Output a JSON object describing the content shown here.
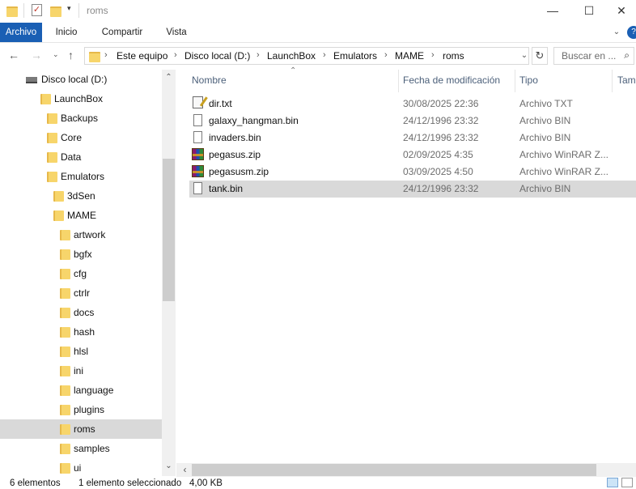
{
  "window": {
    "title": "roms",
    "minimize": "—",
    "maximize": "☐",
    "close": "✕"
  },
  "ribbon": {
    "tabs": [
      "Archivo",
      "Inicio",
      "Compartir",
      "Vista"
    ]
  },
  "address": {
    "crumbs": [
      "Este equipo",
      "Disco local (D:)",
      "LaunchBox",
      "Emulators",
      "MAME",
      "roms"
    ],
    "search_placeholder": "Buscar en ..."
  },
  "nav_tree": [
    {
      "label": "Disco local (D:)",
      "type": "drive",
      "indent": 0,
      "selected": false
    },
    {
      "label": "LaunchBox",
      "type": "folder",
      "indent": 1,
      "selected": false
    },
    {
      "label": "Backups",
      "type": "folder",
      "indent": 2,
      "selected": false
    },
    {
      "label": "Core",
      "type": "folder",
      "indent": 2,
      "selected": false
    },
    {
      "label": "Data",
      "type": "folder",
      "indent": 2,
      "selected": false
    },
    {
      "label": "Emulators",
      "type": "folder",
      "indent": 2,
      "selected": false
    },
    {
      "label": "3dSen",
      "type": "folder",
      "indent": 3,
      "selected": false
    },
    {
      "label": "MAME",
      "type": "folder",
      "indent": 3,
      "selected": false
    },
    {
      "label": "artwork",
      "type": "folder",
      "indent": 4,
      "selected": false
    },
    {
      "label": "bgfx",
      "type": "folder",
      "indent": 4,
      "selected": false
    },
    {
      "label": "cfg",
      "type": "folder",
      "indent": 4,
      "selected": false
    },
    {
      "label": "ctrlr",
      "type": "folder",
      "indent": 4,
      "selected": false
    },
    {
      "label": "docs",
      "type": "folder",
      "indent": 4,
      "selected": false
    },
    {
      "label": "hash",
      "type": "folder",
      "indent": 4,
      "selected": false
    },
    {
      "label": "hlsl",
      "type": "folder",
      "indent": 4,
      "selected": false
    },
    {
      "label": "ini",
      "type": "folder",
      "indent": 4,
      "selected": false
    },
    {
      "label": "language",
      "type": "folder",
      "indent": 4,
      "selected": false
    },
    {
      "label": "plugins",
      "type": "folder",
      "indent": 4,
      "selected": false
    },
    {
      "label": "roms",
      "type": "folder",
      "indent": 4,
      "selected": true
    },
    {
      "label": "samples",
      "type": "folder",
      "indent": 4,
      "selected": false
    },
    {
      "label": "ui",
      "type": "folder",
      "indent": 4,
      "selected": false
    }
  ],
  "columns": {
    "name": "Nombre",
    "date": "Fecha de modificación",
    "type": "Tipo",
    "size": "Tama"
  },
  "files": [
    {
      "name": "dir.txt",
      "date": "30/08/2025 22:36",
      "type": "Archivo TXT",
      "icon": "text-file-icon",
      "selected": false
    },
    {
      "name": "galaxy_hangman.bin",
      "date": "24/12/1996 23:32",
      "type": "Archivo BIN",
      "icon": "file-icon",
      "selected": false
    },
    {
      "name": "invaders.bin",
      "date": "24/12/1996 23:32",
      "type": "Archivo BIN",
      "icon": "file-icon",
      "selected": false
    },
    {
      "name": "pegasus.zip",
      "date": "02/09/2025 4:35",
      "type": "Archivo WinRAR Z...",
      "icon": "winrar-icon",
      "selected": false
    },
    {
      "name": "pegasusm.zip",
      "date": "03/09/2025 4:50",
      "type": "Archivo WinRAR Z...",
      "icon": "winrar-icon",
      "selected": false
    },
    {
      "name": "tank.bin",
      "date": "24/12/1996 23:32",
      "type": "Archivo BIN",
      "icon": "file-icon",
      "selected": true
    }
  ],
  "status": {
    "count": "6 elementos",
    "selection": "1 elemento seleccionado",
    "size": "4,00 KB"
  },
  "colors": {
    "accent": "#1a5fb4",
    "selection": "#d9d9d9",
    "folder": "#f7d56b"
  }
}
